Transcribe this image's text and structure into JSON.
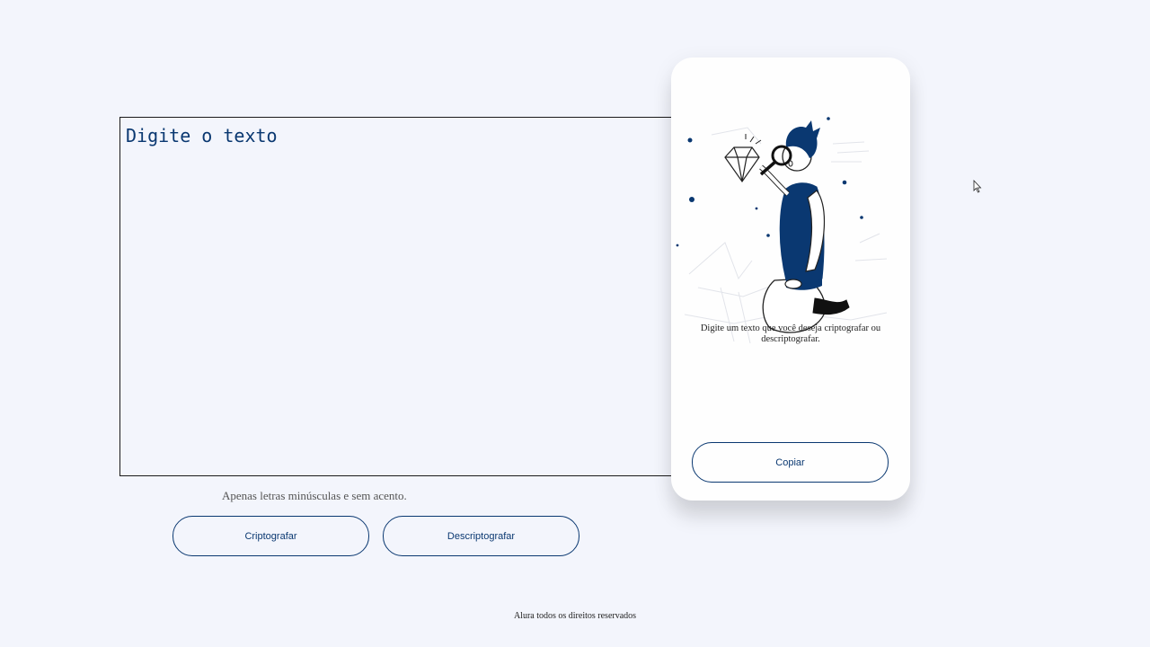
{
  "input": {
    "placeholder": "Digite o texto",
    "value": ""
  },
  "hint": {
    "text": "Apenas letras minúsculas e sem acento."
  },
  "buttons": {
    "encrypt_label": "Criptografar",
    "decrypt_label": "Descriptografar"
  },
  "output_card": {
    "message": "Digite um texto que você deseja criptografar ou descriptografar.",
    "copy_label": "Copiar",
    "illustration_icon": "person-with-magnifying-glass-and-diamond"
  },
  "footer": {
    "text": "Alura todos os direitos reservados"
  },
  "colors": {
    "accent": "#0a3871",
    "background": "#f3f5fc",
    "card": "#fefefe"
  }
}
